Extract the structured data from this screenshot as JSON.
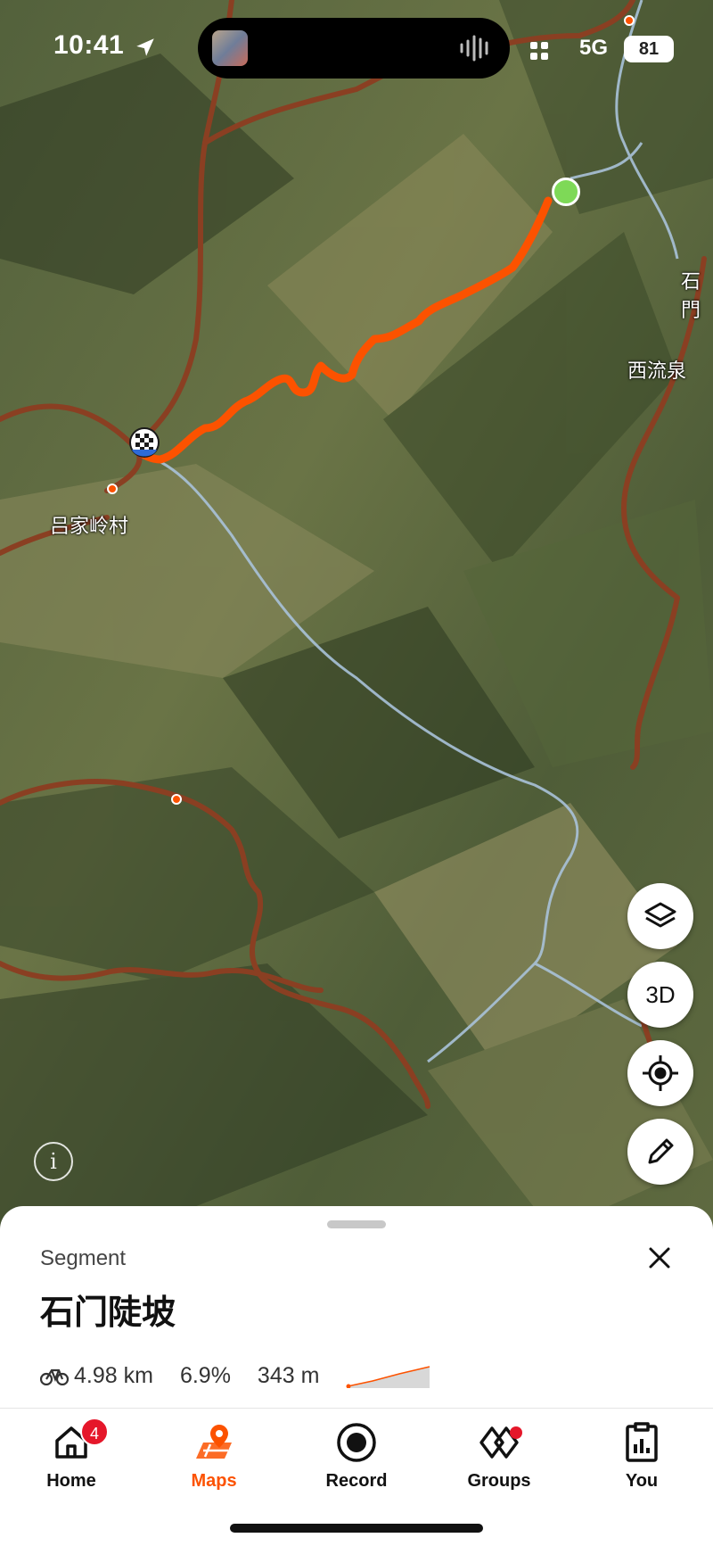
{
  "status_bar": {
    "time": "10:41",
    "network": "5G",
    "battery": "81"
  },
  "map": {
    "places": [
      "石門",
      "西流泉",
      "吕家岭村"
    ],
    "controls": {
      "three_d_label": "3D"
    },
    "info_glyph": "i"
  },
  "segment": {
    "type_label": "Segment",
    "name": "石门陡坡",
    "distance": "4.98 km",
    "grade": "6.9%",
    "elevation": "343 m"
  },
  "tabs": [
    {
      "label": "Home",
      "badge": "4",
      "icon": "home-icon"
    },
    {
      "label": "Maps",
      "icon": "maps-icon",
      "active": true
    },
    {
      "label": "Record",
      "icon": "record-icon"
    },
    {
      "label": "Groups",
      "icon": "groups-icon"
    },
    {
      "label": "You",
      "icon": "you-icon"
    }
  ],
  "colors": {
    "accent": "#fc5200",
    "route": "#fc5200",
    "road": "#8a3f22",
    "start": "#7ed957",
    "badge": "#e5172a"
  }
}
